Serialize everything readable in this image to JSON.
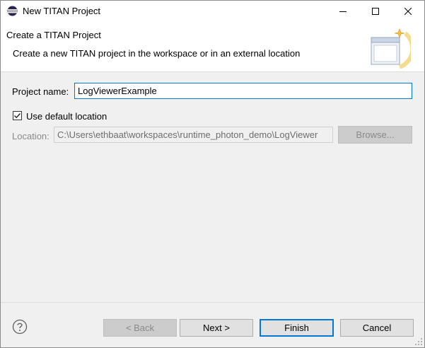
{
  "window": {
    "title": "New TITAN Project",
    "icons": {
      "app": "eclipse-icon",
      "minimize": "minimize-icon",
      "maximize": "maximize-icon",
      "close": "close-icon"
    }
  },
  "banner": {
    "title": "Create a TITAN Project",
    "description": "Create a new TITAN project in the workspace or in an external location",
    "image": "new-project-wizard-icon"
  },
  "form": {
    "project_name_label": "Project name:",
    "project_name_value": "LogViewerExample",
    "use_default_location_label": "Use default location",
    "use_default_location_checked": true,
    "location_label": "Location:",
    "location_value": "C:\\Users\\ethbaat\\workspaces\\runtime_photon_demo\\LogViewer",
    "browse_label": "Browse..."
  },
  "buttons": {
    "help_icon": "help-icon",
    "back": "< Back",
    "next": "Next >",
    "finish": "Finish",
    "cancel": "Cancel"
  },
  "colors": {
    "accent": "#0078d7",
    "dialog_bg": "#f0f0f0",
    "button_bg": "#e1e1e1",
    "disabled_text": "#8a8a8a"
  }
}
